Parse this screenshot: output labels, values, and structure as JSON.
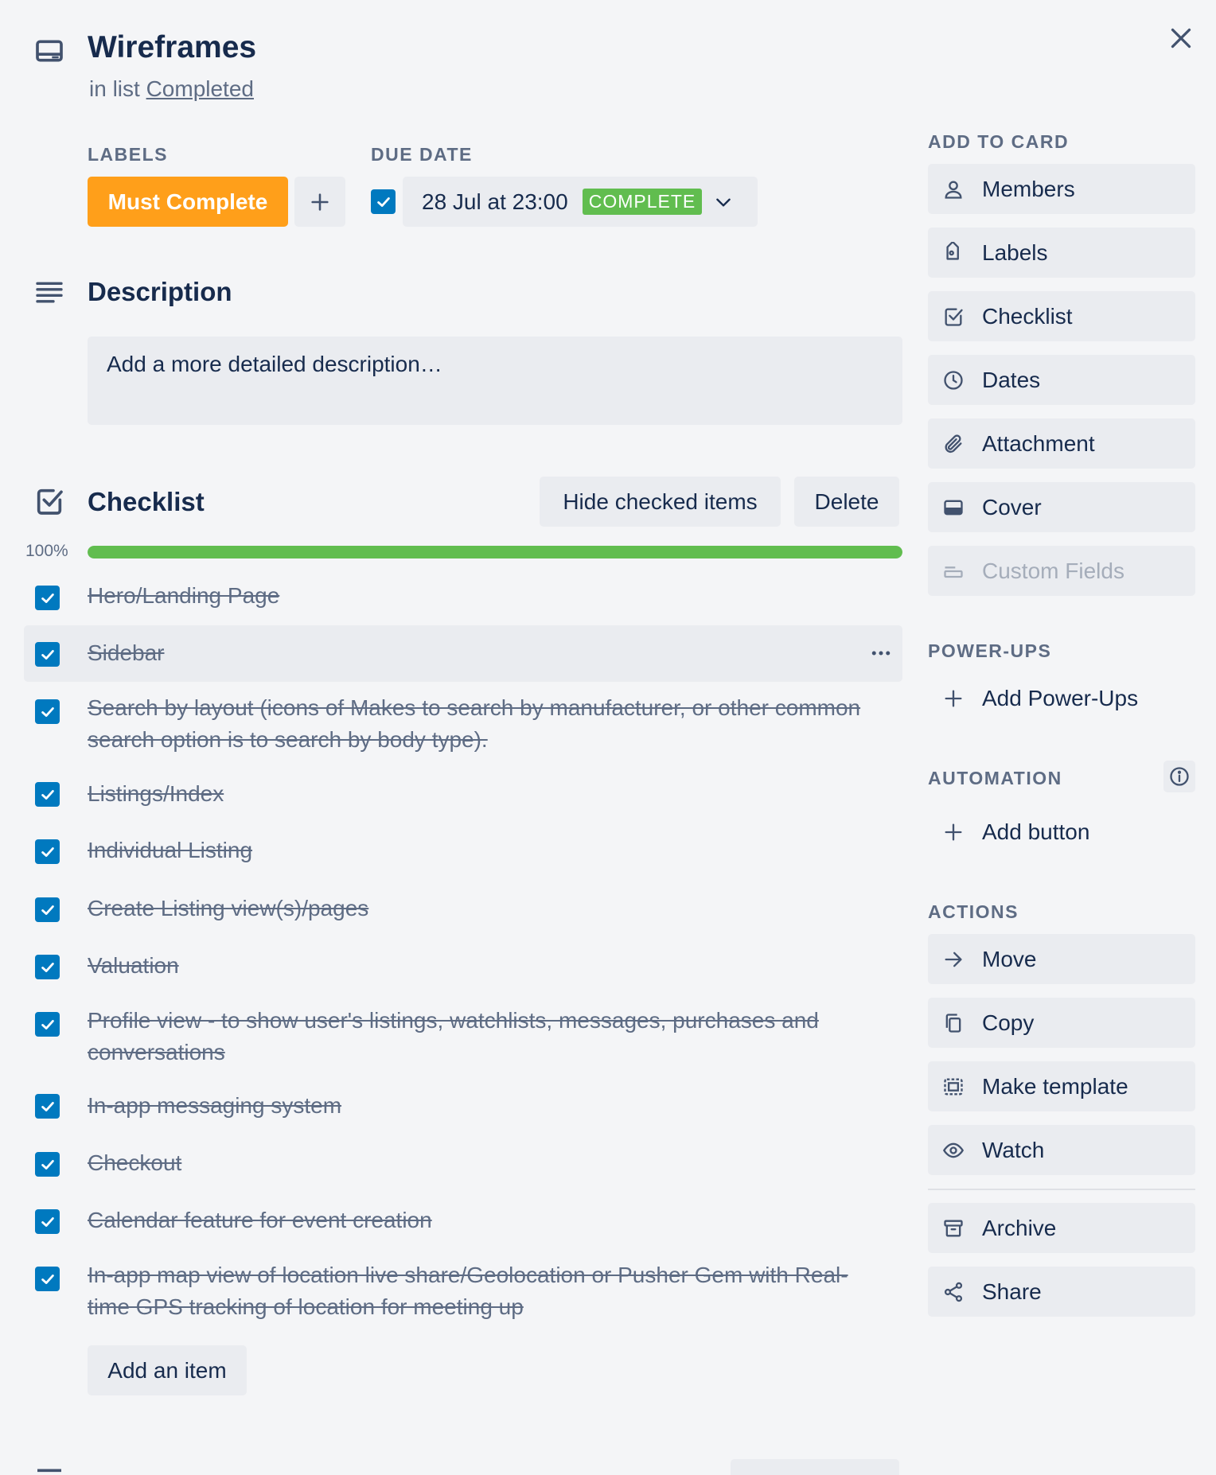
{
  "header": {
    "title": "Wireframes",
    "in_list_prefix": "in list",
    "list_name": "Completed"
  },
  "labels": {
    "heading": "LABELS",
    "chip": "Must Complete",
    "chip_color": "#ff9f1a"
  },
  "due_date": {
    "heading": "DUE DATE",
    "value": "28 Jul at 23:00",
    "badge": "COMPLETE",
    "badge_color": "#61bd4f",
    "checked": true
  },
  "description": {
    "title": "Description",
    "placeholder": "Add a more detailed description…"
  },
  "checklist": {
    "title": "Checklist",
    "hide_button": "Hide checked items",
    "delete_button": "Delete",
    "progress_label": "100%",
    "progress": 1.0,
    "progress_color": "#61bd4f",
    "items": [
      {
        "text": "Hero/Landing Page",
        "checked": true
      },
      {
        "text": "Sidebar",
        "checked": true
      },
      {
        "text": "Search by layout (icons of Makes to search by manufacturer, or other common search option is to search by body type).",
        "checked": true
      },
      {
        "text": "Listings/Index",
        "checked": true
      },
      {
        "text": "Individual Listing",
        "checked": true
      },
      {
        "text": "Create Listing view(s)/pages",
        "checked": true
      },
      {
        "text": "Valuation",
        "checked": true
      },
      {
        "text": "Profile view - to show user's listings, watchlists, messages, purchases and conversations",
        "checked": true
      },
      {
        "text": "In-app messaging system",
        "checked": true
      },
      {
        "text": "Checkout",
        "checked": true
      },
      {
        "text": "Calendar feature for event creation",
        "checked": true
      },
      {
        "text": "In-app map view of location live share/Geolocation or Pusher Gem with Real-time GPS tracking of location for meeting up",
        "checked": true
      }
    ],
    "add_item": "Add an item"
  },
  "sidebar": {
    "add_to_card": {
      "heading": "ADD TO CARD",
      "items": [
        {
          "label": "Members",
          "icon": "person-icon"
        },
        {
          "label": "Labels",
          "icon": "tag-icon"
        },
        {
          "label": "Checklist",
          "icon": "checklist-icon"
        },
        {
          "label": "Dates",
          "icon": "clock-icon"
        },
        {
          "label": "Attachment",
          "icon": "paperclip-icon"
        },
        {
          "label": "Cover",
          "icon": "cover-icon"
        },
        {
          "label": "Custom Fields",
          "icon": "custom-fields-icon",
          "disabled": true
        }
      ]
    },
    "power_ups": {
      "heading": "POWER-UPS",
      "add": "Add Power-Ups"
    },
    "automation": {
      "heading": "AUTOMATION",
      "add": "Add button"
    },
    "actions": {
      "heading": "ACTIONS",
      "items": [
        {
          "label": "Move",
          "icon": "arrow-right-icon"
        },
        {
          "label": "Copy",
          "icon": "copy-icon"
        },
        {
          "label": "Make template",
          "icon": "template-icon"
        },
        {
          "label": "Watch",
          "icon": "eye-icon"
        },
        {
          "label": "Archive",
          "icon": "archive-icon"
        },
        {
          "label": "Share",
          "icon": "share-icon"
        }
      ]
    }
  }
}
